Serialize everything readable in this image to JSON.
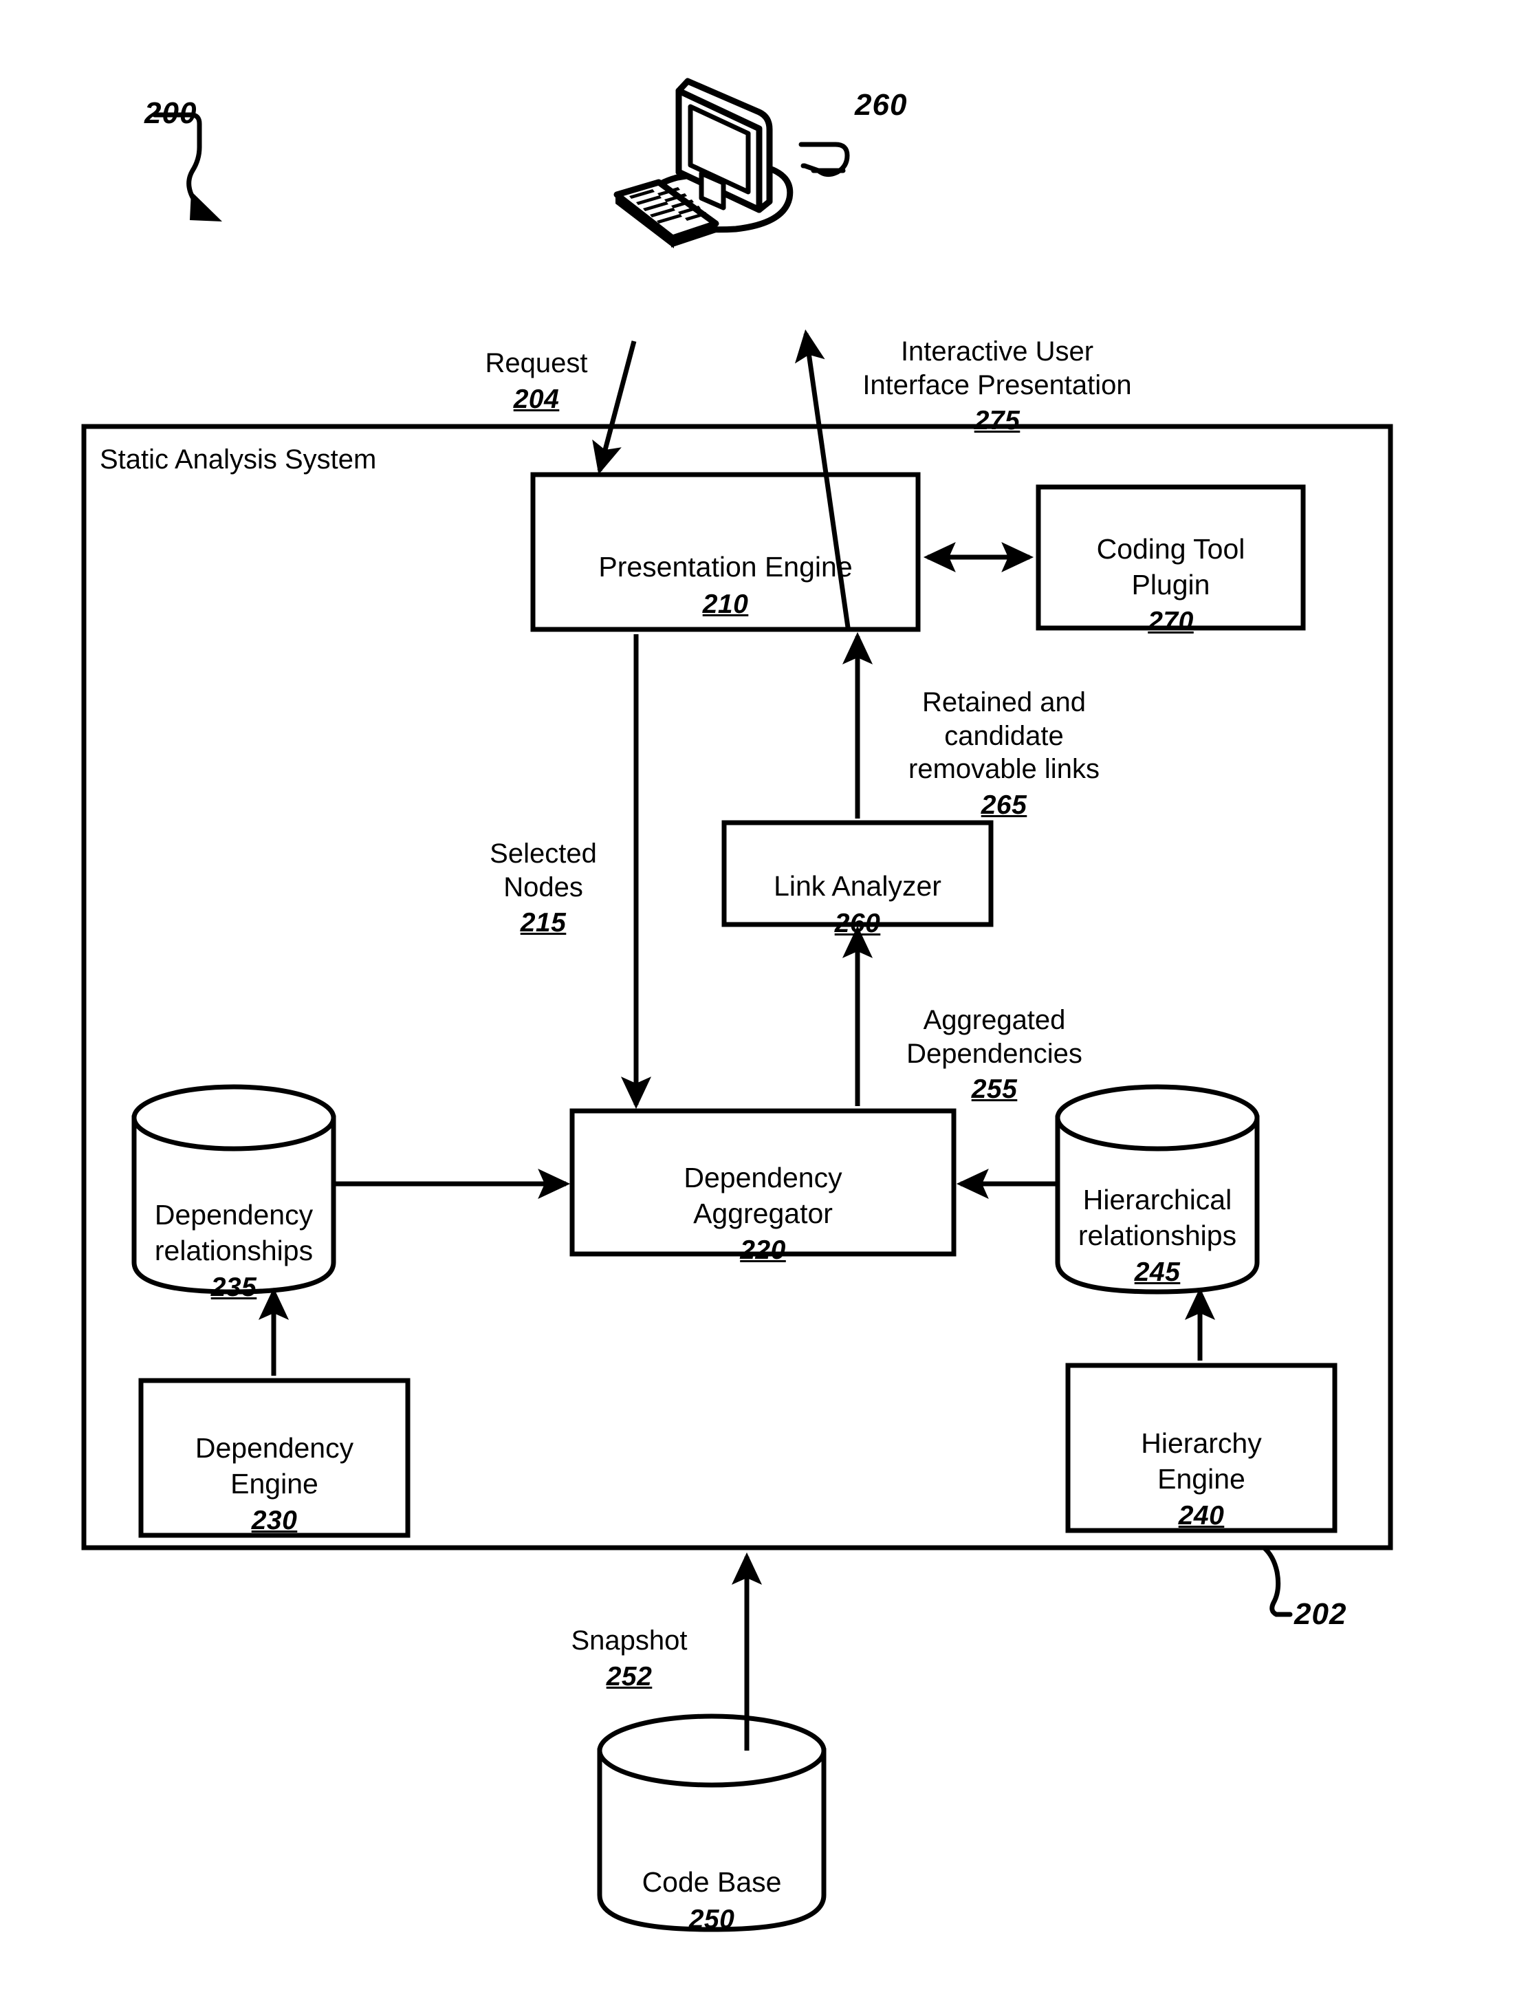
{
  "figure": {
    "number": "200",
    "system_boundary_ref": "202"
  },
  "devices": {
    "workstation": {
      "name": "computer-workstation",
      "ref": "260"
    }
  },
  "flows": [
    {
      "id": "request",
      "label": "Request",
      "ref": "204"
    },
    {
      "id": "ui-presentation",
      "label": "Interactive User\nInterface Presentation",
      "ref": "275"
    },
    {
      "id": "retained-links",
      "label": "Retained and\ncandidate\nremovable links",
      "ref": "265"
    },
    {
      "id": "selected-nodes",
      "label": "Selected\nNodes",
      "ref": "215"
    },
    {
      "id": "aggregated-deps",
      "label": "Aggregated\nDependencies",
      "ref": "255"
    },
    {
      "id": "snapshot",
      "label": "Snapshot",
      "ref": "252"
    }
  ],
  "container": {
    "title": "Static Analysis System",
    "ref": "202"
  },
  "nodes": [
    {
      "id": "presentation-engine",
      "label": "Presentation Engine",
      "ref": "210",
      "shape": "rect"
    },
    {
      "id": "coding-tool-plugin",
      "label": "Coding Tool\nPlugin",
      "ref": "270",
      "shape": "rect"
    },
    {
      "id": "link-analyzer",
      "label": "Link Analyzer",
      "ref": "260",
      "shape": "rect"
    },
    {
      "id": "dependency-aggregator",
      "label": "Dependency\nAggregator",
      "ref": "220",
      "shape": "rect"
    },
    {
      "id": "dependency-relationships",
      "label": "Dependency\nrelationships",
      "ref": "235",
      "shape": "cylinder"
    },
    {
      "id": "hierarchical-relationships",
      "label": "Hierarchical\nrelationships",
      "ref": "245",
      "shape": "cylinder"
    },
    {
      "id": "dependency-engine",
      "label": "Dependency\nEngine",
      "ref": "230",
      "shape": "rect"
    },
    {
      "id": "hierarchy-engine",
      "label": "Hierarchy\nEngine",
      "ref": "240",
      "shape": "rect"
    },
    {
      "id": "code-base",
      "label": "Code Base",
      "ref": "250",
      "shape": "cylinder"
    }
  ],
  "colors": {
    "stroke": "#000000",
    "background": "#ffffff"
  },
  "chart_data": {
    "type": "diagram",
    "title": "Static Analysis System block diagram 200",
    "blocks": [
      {
        "label": "Presentation Engine",
        "ref": "210"
      },
      {
        "label": "Coding Tool Plugin",
        "ref": "270"
      },
      {
        "label": "Link Analyzer",
        "ref": "260"
      },
      {
        "label": "Dependency Aggregator",
        "ref": "220"
      },
      {
        "label": "Dependency relationships",
        "ref": "235"
      },
      {
        "label": "Hierarchical relationships",
        "ref": "245"
      },
      {
        "label": "Dependency Engine",
        "ref": "230"
      },
      {
        "label": "Hierarchy Engine",
        "ref": "240"
      },
      {
        "label": "Code Base",
        "ref": "250"
      }
    ],
    "edges": [
      {
        "from": "computer-workstation",
        "to": "Presentation Engine",
        "label": "Request 204"
      },
      {
        "from": "Presentation Engine",
        "to": "computer-workstation",
        "label": "Interactive User Interface Presentation 275"
      },
      {
        "from": "Presentation Engine",
        "to": "Coding Tool Plugin",
        "label": "",
        "bidirectional": true
      },
      {
        "from": "Link Analyzer",
        "to": "Presentation Engine",
        "label": "Retained and candidate removable links 265"
      },
      {
        "from": "Presentation Engine",
        "to": "Dependency Aggregator",
        "label": "Selected Nodes 215"
      },
      {
        "from": "Dependency Aggregator",
        "to": "Link Analyzer",
        "label": "Aggregated Dependencies 255"
      },
      {
        "from": "Dependency relationships",
        "to": "Dependency Aggregator",
        "label": ""
      },
      {
        "from": "Hierarchical relationships",
        "to": "Dependency Aggregator",
        "label": ""
      },
      {
        "from": "Dependency Engine",
        "to": "Dependency relationships",
        "label": ""
      },
      {
        "from": "Hierarchy Engine",
        "to": "Hierarchical relationships",
        "label": ""
      },
      {
        "from": "Code Base",
        "to": "Static Analysis System",
        "label": "Snapshot 252"
      }
    ]
  }
}
